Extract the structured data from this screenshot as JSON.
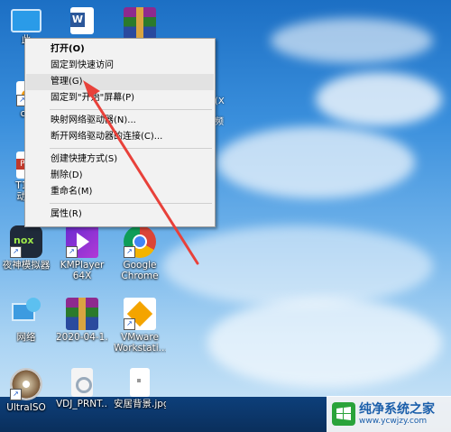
{
  "desktop": {
    "icons": [
      {
        "id": "this-pc",
        "label": "此",
        "icon": "computer-icon"
      },
      {
        "id": "word",
        "label": "",
        "icon": "word-doc-icon"
      },
      {
        "id": "winrar-top",
        "label": "",
        "icon": "winrar-icon"
      },
      {
        "id": "ov",
        "label": "ov",
        "icon": "app-icon"
      },
      {
        "id": "pdf",
        "label": "T10-",
        "label2": "动实",
        "icon": "pdf-icon"
      },
      {
        "id": "nox",
        "label": "夜神模拟器",
        "icon": "nox-icon"
      },
      {
        "id": "kmplayer",
        "label": "KMPlayer",
        "label2": "64X",
        "icon": "kmplayer-icon"
      },
      {
        "id": "chrome",
        "label": "Google",
        "label2": "Chrome",
        "icon": "chrome-icon"
      },
      {
        "id": "network",
        "label": "网络",
        "icon": "network-icon"
      },
      {
        "id": "winrar-2020",
        "label": "2020-04-1...",
        "icon": "winrar-icon"
      },
      {
        "id": "vmware",
        "label": "VMware",
        "label2": "Workstati...",
        "icon": "vmware-icon"
      },
      {
        "id": "ultraiso",
        "label": "UltraISO",
        "icon": "ultraiso-icon"
      },
      {
        "id": "vdj",
        "label": "VDJ_PRNT...",
        "icon": "settings-file-icon"
      },
      {
        "id": "wallpaper",
        "label": "安居背景.jpg",
        "icon": "image-file-icon"
      }
    ],
    "right_fragment_1": "(X",
    "right_fragment_2": "频"
  },
  "context_menu": {
    "items": [
      {
        "label": "打开(O)",
        "bold": true
      },
      {
        "label": "固定到快速访问"
      },
      {
        "label": "管理(G)",
        "highlighted": true
      },
      {
        "label": "固定到\"开始\"屏幕(P)"
      },
      {
        "label": "映射网络驱动器(N)..."
      },
      {
        "label": "断开网络驱动器的连接(C)..."
      },
      {
        "label": "创建快捷方式(S)"
      },
      {
        "label": "删除(D)"
      },
      {
        "label": "重命名(M)"
      },
      {
        "label": "属性(R)"
      }
    ]
  },
  "watermark": {
    "title": "纯净系统之家",
    "url": "www.ycwjzy.com"
  },
  "colors": {
    "menu_bg": "#f2f2f2",
    "highlight": "#e2e2e2",
    "arrow": "#e8413a"
  }
}
